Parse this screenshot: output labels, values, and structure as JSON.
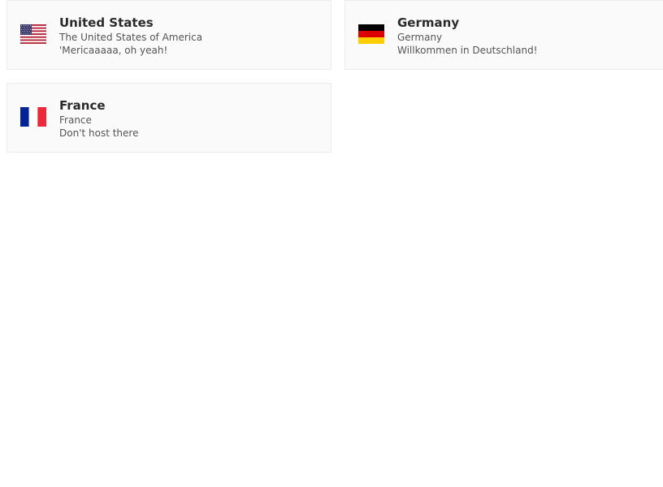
{
  "countries": [
    {
      "name": "United States",
      "official_name": "The United States of America",
      "tagline": "'Mericaaaaa, oh yeah!",
      "flag_icon": "us-flag-icon",
      "colors": {
        "red": "#b22234",
        "white": "#ffffff",
        "blue": "#3c3b6e"
      }
    },
    {
      "name": "Germany",
      "official_name": "Germany",
      "tagline": "Willkommen in Deutschland!",
      "flag_icon": "germany-flag-icon",
      "colors": {
        "black": "#000000",
        "red": "#dd0000",
        "gold": "#ffce00"
      }
    },
    {
      "name": "France",
      "official_name": "France",
      "tagline": "Don't host there",
      "flag_icon": "france-flag-icon",
      "colors": {
        "blue": "#002395",
        "white": "#ffffff",
        "red": "#ed2939"
      }
    }
  ]
}
